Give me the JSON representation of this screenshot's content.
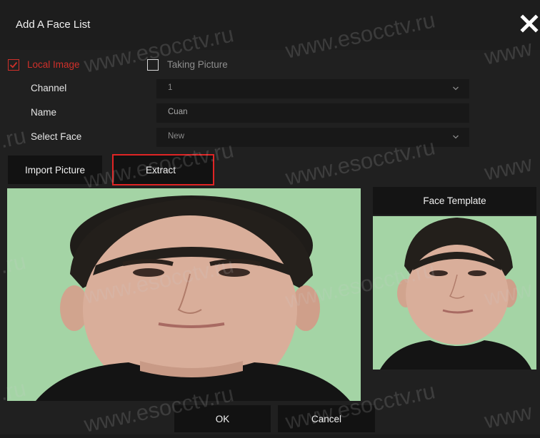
{
  "dialog": {
    "title": "Add A Face List"
  },
  "source": {
    "local_label": "Local Image",
    "local_checked": true,
    "taking_label": "Taking Picture",
    "taking_checked": false
  },
  "form": {
    "channel": {
      "label": "Channel",
      "value": "1"
    },
    "name": {
      "label": "Name",
      "value": "Cuan"
    },
    "select_face": {
      "label": "Select Face",
      "value": "New"
    }
  },
  "actions": {
    "import_label": "Import Picture",
    "extract_label": "Extract",
    "ok_label": "OK",
    "cancel_label": "Cancel"
  },
  "template": {
    "title": "Face Template"
  },
  "watermark": {
    "text": "www.esocctv.ru",
    "fragment_left": ".ru",
    "fragment_right": "www"
  },
  "icons": {
    "close": "close-icon",
    "checkbox_checked": "checkbox-checked-icon",
    "checkbox_empty": "checkbox-empty-icon",
    "dropdown": "chevron-down-icon"
  },
  "colors": {
    "accent": "#d0302a",
    "highlight": "#e02424",
    "background": "#202020",
    "photo_background": "#9bcf9d"
  }
}
